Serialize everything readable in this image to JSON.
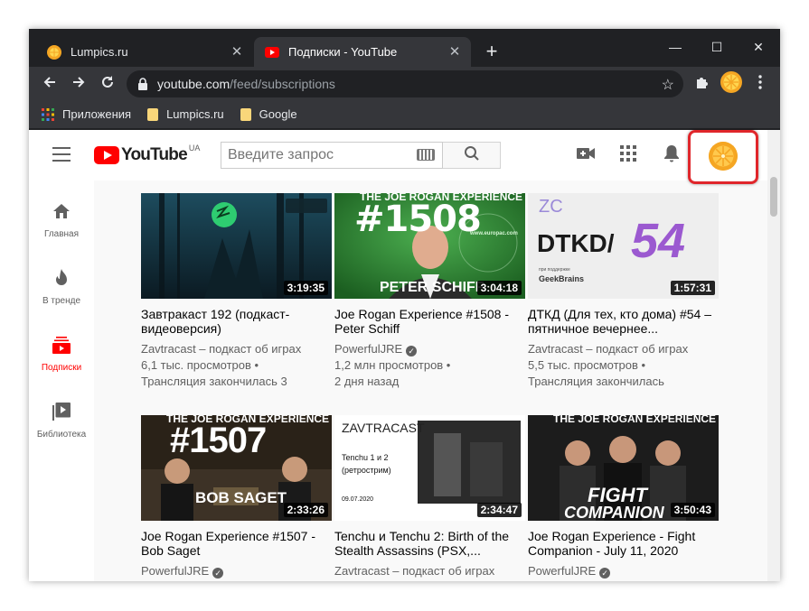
{
  "browser": {
    "tabs": [
      {
        "label": "Lumpics.ru",
        "close": "✕"
      },
      {
        "label": "Подписки - YouTube",
        "close": "✕"
      }
    ],
    "new_tab": "+",
    "window_controls": {
      "minimize": "—",
      "maximize": "☐",
      "close": "✕"
    },
    "address": {
      "host": "youtube.com",
      "path": "/feed/subscriptions"
    },
    "bookmarks": [
      {
        "label": "Приложения"
      },
      {
        "label": "Lumpics.ru"
      },
      {
        "label": "Google"
      }
    ],
    "colors": {
      "frame": "#202124",
      "toolbar": "#35363a"
    }
  },
  "youtube": {
    "logo_text": "YouTube",
    "region": "UA",
    "search_placeholder": "Введите запрос",
    "highlight_color": "#e0262b",
    "guide": [
      {
        "label": "Главная",
        "icon": "home-icon"
      },
      {
        "label": "В тренде",
        "icon": "fire-icon"
      },
      {
        "label": "Подписки",
        "icon": "subscriptions-icon",
        "active": true
      },
      {
        "label": "Библиотека",
        "icon": "library-icon"
      }
    ],
    "videos": [
      {
        "title": "Завтракаст 192 (подкаст-видеоверсия)",
        "channel": "Zavtracast – подкаст об играх",
        "views": "6,1 тыс. просмотров •",
        "when": "Трансляция закончилась 3",
        "duration": "3:19:35",
        "verified": false
      },
      {
        "title": "Joe Rogan Experience #1508 - Peter Schiff",
        "channel": "PowerfulJRE",
        "views": "1,2 млн просмотров •",
        "when": "2 дня назад",
        "duration": "3:04:18",
        "verified": true
      },
      {
        "title": "ДТКД (Для тех, кто дома) #54 – пятничное вечернее...",
        "channel": "Zavtracast – подкаст об играх",
        "views": "5,5 тыс. просмотров •",
        "when": "Трансляция закончилась",
        "duration": "1:57:31",
        "verified": false
      },
      {
        "title": "Joe Rogan Experience #1507 - Bob Saget",
        "channel": "PowerfulJRE",
        "views": "",
        "when": "",
        "duration": "2:33:26",
        "verified": true
      },
      {
        "title": "Tenchu и Tenchu 2: Birth of the Stealth Assassins (PSX,...",
        "channel": "Zavtracast – подкаст об играх",
        "views": "",
        "when": "",
        "duration": "2:34:47",
        "verified": false
      },
      {
        "title": "Joe Rogan Experience - Fight Companion - July 11, 2020",
        "channel": "PowerfulJRE",
        "views": "",
        "when": "",
        "duration": "3:50:43",
        "verified": true
      }
    ],
    "thumb_text": {
      "jre_header": "THE JOE ROGAN EXPERIENCE",
      "jre_1508_num": "#1508",
      "jre_1508_name": "PETER SCHIFF",
      "jre_1508_url": "www.europac.com",
      "dtkd_brand": "ZC",
      "dtkd_title": "DTKD/",
      "dtkd_num": "54",
      "dtkd_sponsor": "GeekBrains",
      "sponsor_note": "при поддержке",
      "jre_1507_num": "#1507",
      "jre_1507_name": "BOB SAGET",
      "zc_brand": "ZAVTRACAST",
      "tenchu_line1": "Tenchu 1 и 2",
      "tenchu_line2": "(ретрострим)",
      "tenchu_date": "09.07.2020",
      "fight_line1": "FIGHT",
      "fight_line2": "COMPANION"
    }
  }
}
